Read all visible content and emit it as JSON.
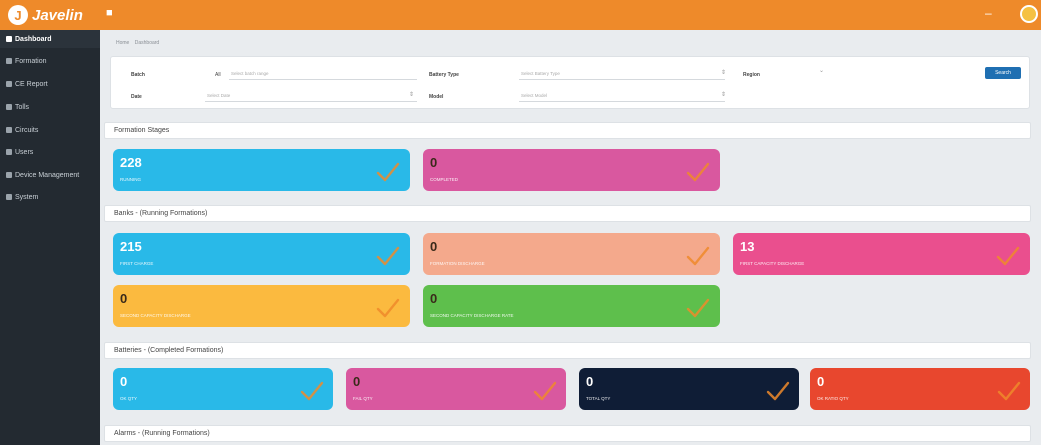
{
  "app": {
    "title": "Javelin"
  },
  "sidebar": {
    "items": [
      {
        "label": "Dashboard",
        "icon": "dashboard-icon",
        "active": true
      },
      {
        "label": "Formation",
        "icon": "formation-icon"
      },
      {
        "label": "CE Report",
        "icon": "report-icon"
      },
      {
        "label": "Tolls",
        "icon": "tools-icon"
      },
      {
        "label": "Circuits",
        "icon": "circuit-icon"
      },
      {
        "label": "Users",
        "icon": "users-icon"
      },
      {
        "label": "Device Management",
        "icon": "device-icon"
      },
      {
        "label": "System",
        "icon": "system-icon"
      }
    ]
  },
  "breadcrumb": [
    "Home",
    "Dashboard"
  ],
  "filter": {
    "batch_label": "Batch",
    "batch_prefix": "All",
    "batch_placeholder": "Select batch range",
    "battery_type_label": "Battery Type",
    "battery_type_placeholder": "Select Battery Type",
    "region_label": "Region",
    "date_label": "Date",
    "date_placeholder": "Select Date",
    "model_label": "Model",
    "model_placeholder": "Select Model",
    "search_label": "Search"
  },
  "sections": {
    "formation_stages": "Formation Stages",
    "banks_running": "Banks - (Running Formations)",
    "batteries_completed": "Batteries - (Completed Formations)",
    "alarms_running": "Alarms - (Running Formations)"
  },
  "cards": {
    "formation_stages": [
      {
        "value": "228",
        "label": "Running",
        "color": "#29b9e8"
      },
      {
        "value": "0",
        "label": "Completed",
        "color": "#d9589f"
      }
    ],
    "banks": [
      {
        "value": "215",
        "label": "First Charge",
        "color": "#29b9e8"
      },
      {
        "value": "0",
        "label": "Formation Discharge",
        "color": "#f4a98c"
      },
      {
        "value": "13",
        "label": "First Capacity Discharge",
        "color": "#ea4f8e"
      },
      {
        "value": "0",
        "label": "Second Capacity Discharge",
        "color": "#fbba3f"
      },
      {
        "value": "0",
        "label": "Second Capacity Discharge Rate",
        "color": "#5ebf4c"
      }
    ],
    "batteries": [
      {
        "value": "0",
        "label": "OK QTY",
        "color": "#29b9e8"
      },
      {
        "value": "0",
        "label": "Fail QTY",
        "color": "#d9589f"
      },
      {
        "value": "0",
        "label": "Total QTY",
        "color": "#0f1d36"
      },
      {
        "value": "0",
        "label": "Ok Ratio QTY",
        "color": "#e8472e"
      }
    ]
  },
  "icons": {
    "check": "check-icon",
    "user": "user-avatar-icon",
    "minimize": "minimize-icon",
    "menu": "menu-icon"
  },
  "colors": {
    "brand": "#ee8a2a",
    "sidebar": "#232a31",
    "check": "#ee8a2a"
  }
}
